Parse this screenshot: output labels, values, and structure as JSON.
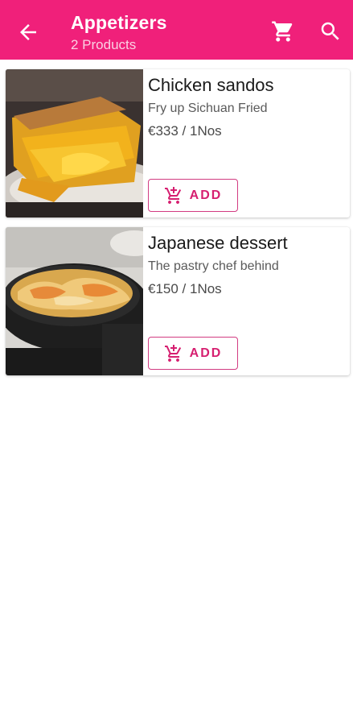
{
  "appbar": {
    "title": "Appetizers",
    "subtitle": "2 Products",
    "back_icon": "arrow-left-icon",
    "cart_icon": "cart-icon",
    "search_icon": "search-icon",
    "background_color": "#f0207a"
  },
  "products": [
    {
      "name": "Chicken sandos",
      "description": "Fry up Sichuan Fried",
      "price": "€333 / 1Nos",
      "add_label": "ADD",
      "image": "pie-slice-photo"
    },
    {
      "name": "Japanese dessert",
      "description": "The pastry chef behind",
      "price": "€150 / 1Nos",
      "add_label": "ADD",
      "image": "skillet-dish-photo"
    }
  ],
  "colors": {
    "accent": "#d61f70",
    "button_border": "#d23c82"
  }
}
